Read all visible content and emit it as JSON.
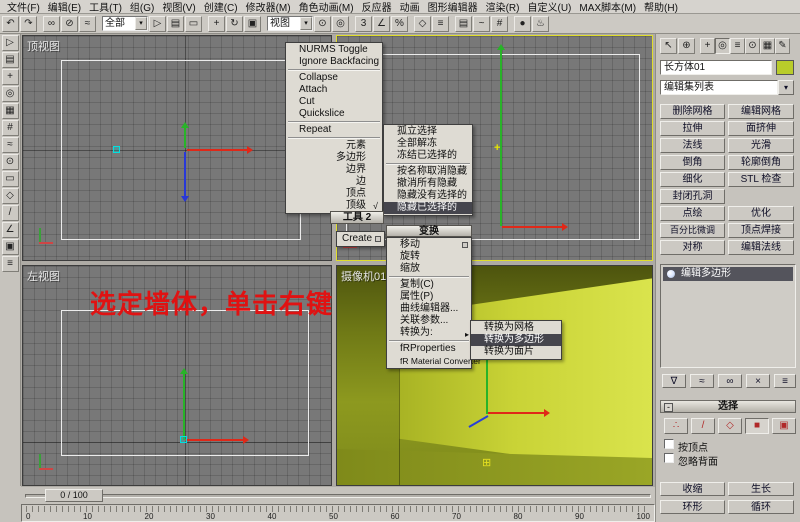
{
  "menu_bar": {
    "items": [
      "文件(F)",
      "编辑(E)",
      "工具(T)",
      "组(G)",
      "视图(V)",
      "创建(C)",
      "修改器(M)",
      "角色动画(M)",
      "反应器",
      "动画",
      "图形编辑器",
      "渲染(R)",
      "自定义(U)",
      "MAX脚本(M)",
      "帮助(H)"
    ]
  },
  "toolbar": {
    "filter_value": "全部",
    "coord_value": "视图"
  },
  "viewports": {
    "top_left_label": "顶视图",
    "bottom_left_label": "左视图",
    "camera_label": "摄像机01"
  },
  "annotation": {
    "text": "选定墙体，单击右键",
    "style": "color:#e01212"
  },
  "quad_menu": {
    "tools1_items": [
      "NURMS Toggle",
      "Ignore Backfacing",
      "Collapse",
      "Attach",
      "Cut",
      "Quickslice",
      "Repeat"
    ],
    "subobject_items": [
      "元素",
      "多边形",
      "边界",
      "边",
      "顶点",
      "顶级"
    ],
    "subobject_checked": "顶级",
    "display_items": [
      "孤立选择",
      "全部解冻",
      "冻结已选择的",
      "按名称取消隐藏",
      "撤消所有隐藏",
      "隐藏没有选择的",
      "隐藏已选择的"
    ],
    "display_highlighted": "隐藏已选择的",
    "tools2_header": "工具 2",
    "create_item": "Create",
    "transform_header": "变换",
    "transform_items": [
      "移动",
      "旋转",
      "缩放",
      "复制(C)",
      "属性(P)",
      "曲线编辑器...",
      "关联参数...",
      "转换为:",
      "fRProperties",
      "fR Material Converter"
    ],
    "convert_items": [
      "转换为网格",
      "转换为多边形",
      "转换为面片"
    ],
    "convert_highlighted": "转换为多边形"
  },
  "command_panel": {
    "object_name": "长方体01",
    "object_color": "#b9cc2a",
    "swatch_style": "background:#b9cc2a",
    "modifier_list_value": "编辑集列表",
    "modifier_buttons": [
      [
        "删除网格",
        "编辑网格"
      ],
      [
        "拉伸",
        "面挤伸"
      ],
      [
        "法线",
        "光滑"
      ],
      [
        "倒角",
        "轮廓倒角"
      ],
      [
        "细化",
        "STL 检查"
      ],
      [
        "封闭孔洞",
        ""
      ],
      [
        "点绘",
        "优化"
      ],
      [
        "百分比微调",
        "顶点焊接"
      ],
      [
        "对称",
        "编辑法线"
      ]
    ],
    "stack_selected": "编辑多边形",
    "selection_header": "选择",
    "by_vertex_label": "按顶点",
    "ignore_backfacing_label": "忽略背面",
    "shrink_label": "收缩",
    "grow_label": "生长",
    "ring_label": "环形",
    "loop_label": "循环"
  },
  "timeline": {
    "slider_label": "0 / 100",
    "tick_labels": [
      "0",
      "10",
      "20",
      "30",
      "40",
      "50",
      "60",
      "70",
      "80",
      "90",
      "100"
    ]
  },
  "glyphs": {
    "undo": "↶",
    "redo": "↷",
    "link": "∞",
    "unlink": "⊘",
    "bind": "≈",
    "select": "▷",
    "select_by_name": "▤",
    "region": "▭",
    "move": "+",
    "rotate": "↻",
    "scale": "▣",
    "coord_center": "⊙",
    "manipulate": "◎",
    "snap": "3",
    "angle_snap": "∠",
    "percent_snap": "%",
    "mirror": "◇",
    "align": "≡",
    "layers": "▤",
    "curve_editor": "~",
    "schematic": "#",
    "material": "●",
    "render": "♨",
    "dropdown": "▾",
    "submenu": "▸",
    "check": "√",
    "minus": "-",
    "grid": "⊞",
    "left_icons": [
      "▷",
      "▤",
      "+",
      "◎",
      "▦",
      "#",
      "≈",
      "⊙",
      "▭",
      "◇",
      "/",
      "∠",
      "▣",
      "≡"
    ],
    "panel_misc": [
      "↖",
      "⊕"
    ],
    "tab_glyphs": [
      "+",
      "◎",
      "≡",
      "⊙",
      "▦",
      "✎"
    ],
    "stack_icons": [
      "∇",
      "≈",
      "∞",
      "×",
      "≡"
    ],
    "so_icons": [
      "∴",
      "/",
      "◇",
      "■",
      "▣"
    ]
  }
}
